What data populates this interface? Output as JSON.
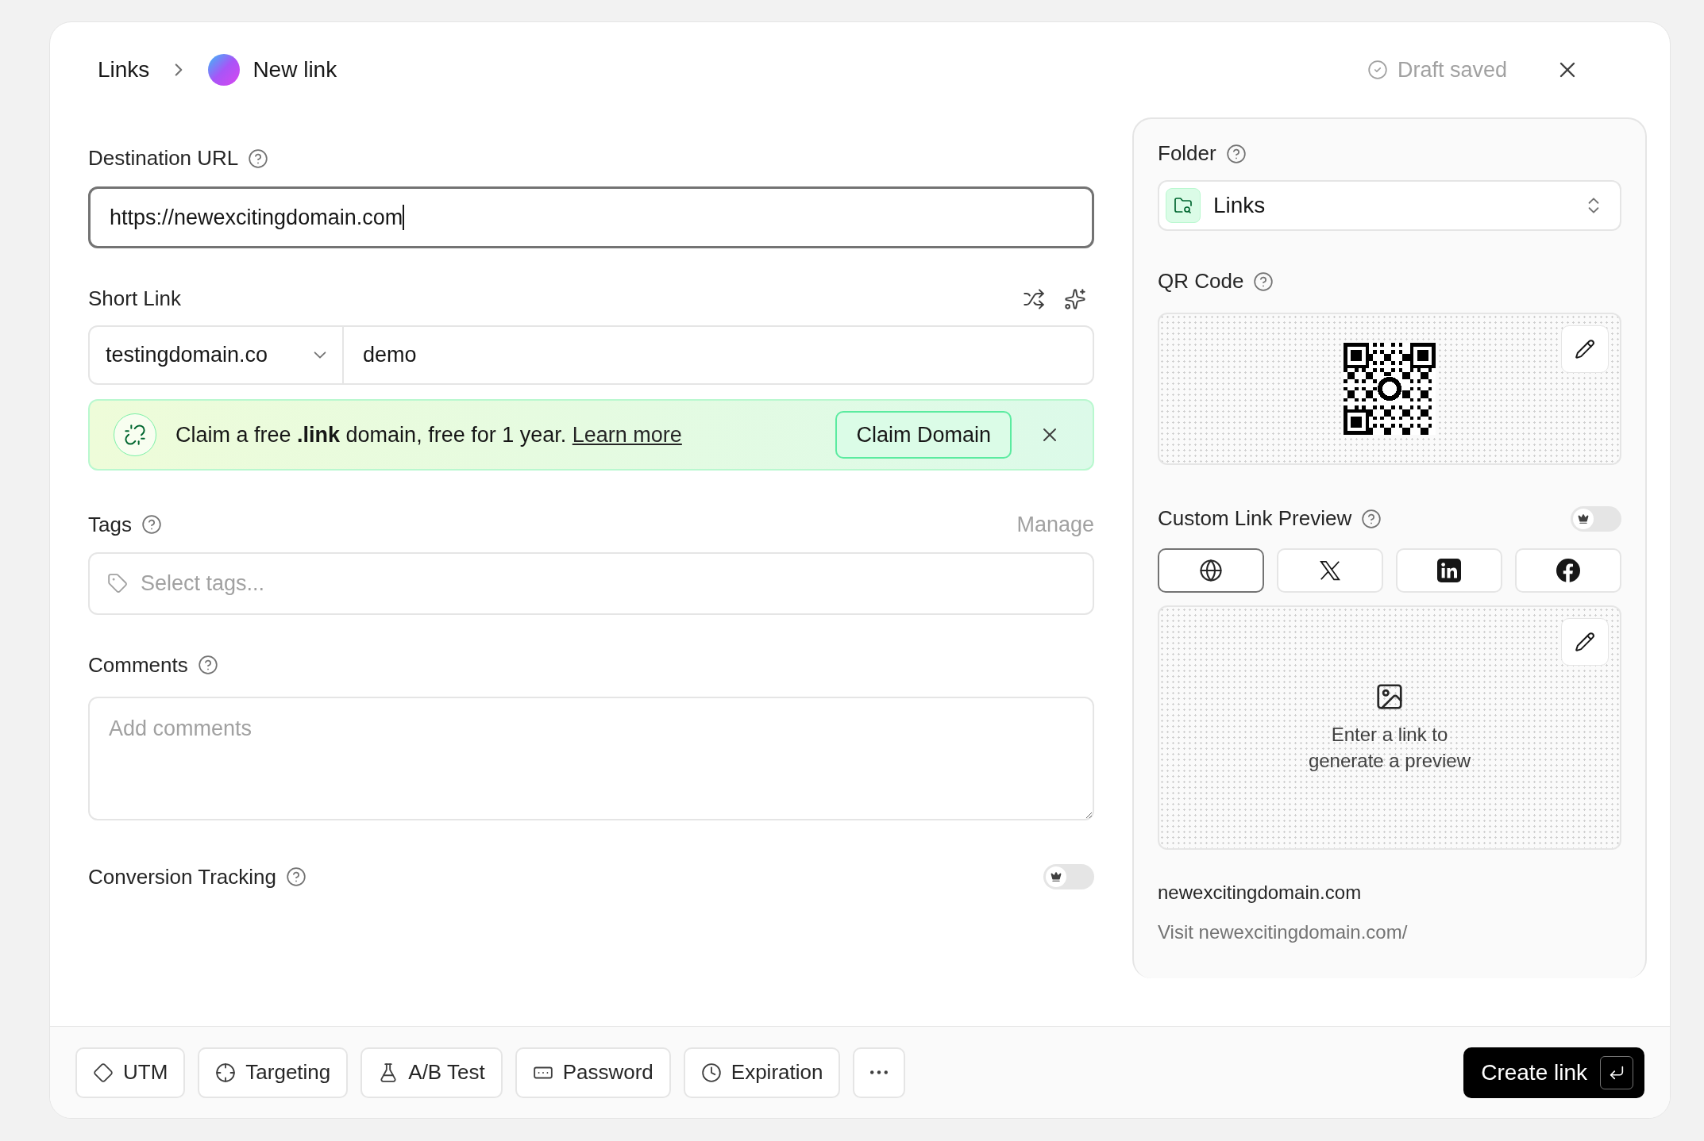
{
  "breadcrumb": {
    "parent": "Links",
    "current": "New link"
  },
  "draft_status": "Draft saved",
  "destination": {
    "label": "Destination URL",
    "value": "https://newexcitingdomain.com",
    "focused": true
  },
  "short_link": {
    "label": "Short Link",
    "domain": "testingdomain.co",
    "key": "demo"
  },
  "banner": {
    "text": "Claim a free **.link** domain, free for 1 year.",
    "link": "Learn more",
    "button": "Claim Domain"
  },
  "tags": {
    "label": "Tags",
    "action": "Manage",
    "placeholder": "Select tags..."
  },
  "comments": {
    "label": "Comments",
    "placeholder": "Add comments"
  },
  "conversion_tracking": {
    "label": "Conversion Tracking",
    "on": false
  },
  "folder": {
    "label": "Folder",
    "value": "Links"
  },
  "qr_code": {
    "label": "QR Code"
  },
  "link_preview": {
    "label": "Custom Link Preview",
    "on": false,
    "tabs": [
      {
        "kind": "web",
        "selected": true
      },
      {
        "kind": "x",
        "selected": false
      },
      {
        "kind": "linkedin",
        "selected": false
      },
      {
        "kind": "facebook",
        "selected": false
      }
    ],
    "empty_text": "Enter a link to generate a preview",
    "title": "newexcitingdomain.com",
    "description": "Visit newexcitingdomain.com/"
  },
  "footer": {
    "options": [
      {
        "kind": "utm",
        "label": "UTM"
      },
      {
        "kind": "targeting",
        "label": "Targeting"
      },
      {
        "kind": "ab_test",
        "label": "A/B Test"
      },
      {
        "kind": "password",
        "label": "Password"
      },
      {
        "kind": "expiration",
        "label": "Expiration"
      },
      {
        "kind": "more"
      }
    ],
    "submit": "Create link"
  }
}
